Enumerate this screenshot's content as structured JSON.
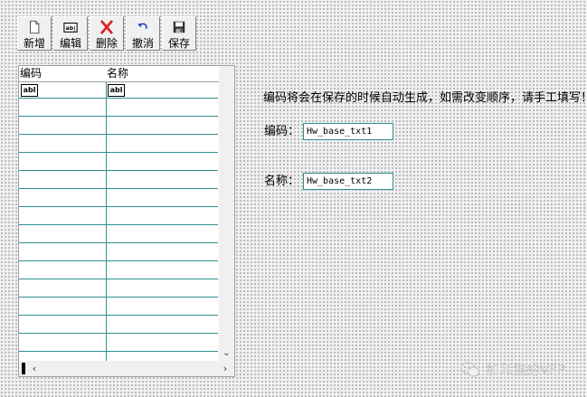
{
  "toolbar": {
    "buttons": [
      {
        "label": "新增",
        "icon": "new-document-icon"
      },
      {
        "label": "编辑",
        "icon": "edit-textbox-icon"
      },
      {
        "label": "删除",
        "icon": "delete-x-icon"
      },
      {
        "label": "撤消",
        "icon": "undo-arrow-icon"
      },
      {
        "label": "保存",
        "icon": "save-floppy-icon"
      }
    ]
  },
  "grid": {
    "columns": [
      "编码",
      "名称"
    ],
    "control_glyph": "abl",
    "row_count": 16
  },
  "form": {
    "note": "编码将会在保存的时候自动生成，如需改变顺序，请手工填写！",
    "code_label": "编码：",
    "code_value": "Hw_base_txt1",
    "name_label": "名称：",
    "name_value": "Hw_base_txt2"
  },
  "watermark": {
    "text": "加菲猫的VFP",
    "icon": "wechat-icon"
  },
  "colors": {
    "grid_line": "#2f8f8f",
    "delete_red": "#e02020",
    "undo_blue": "#1d3bbf"
  }
}
